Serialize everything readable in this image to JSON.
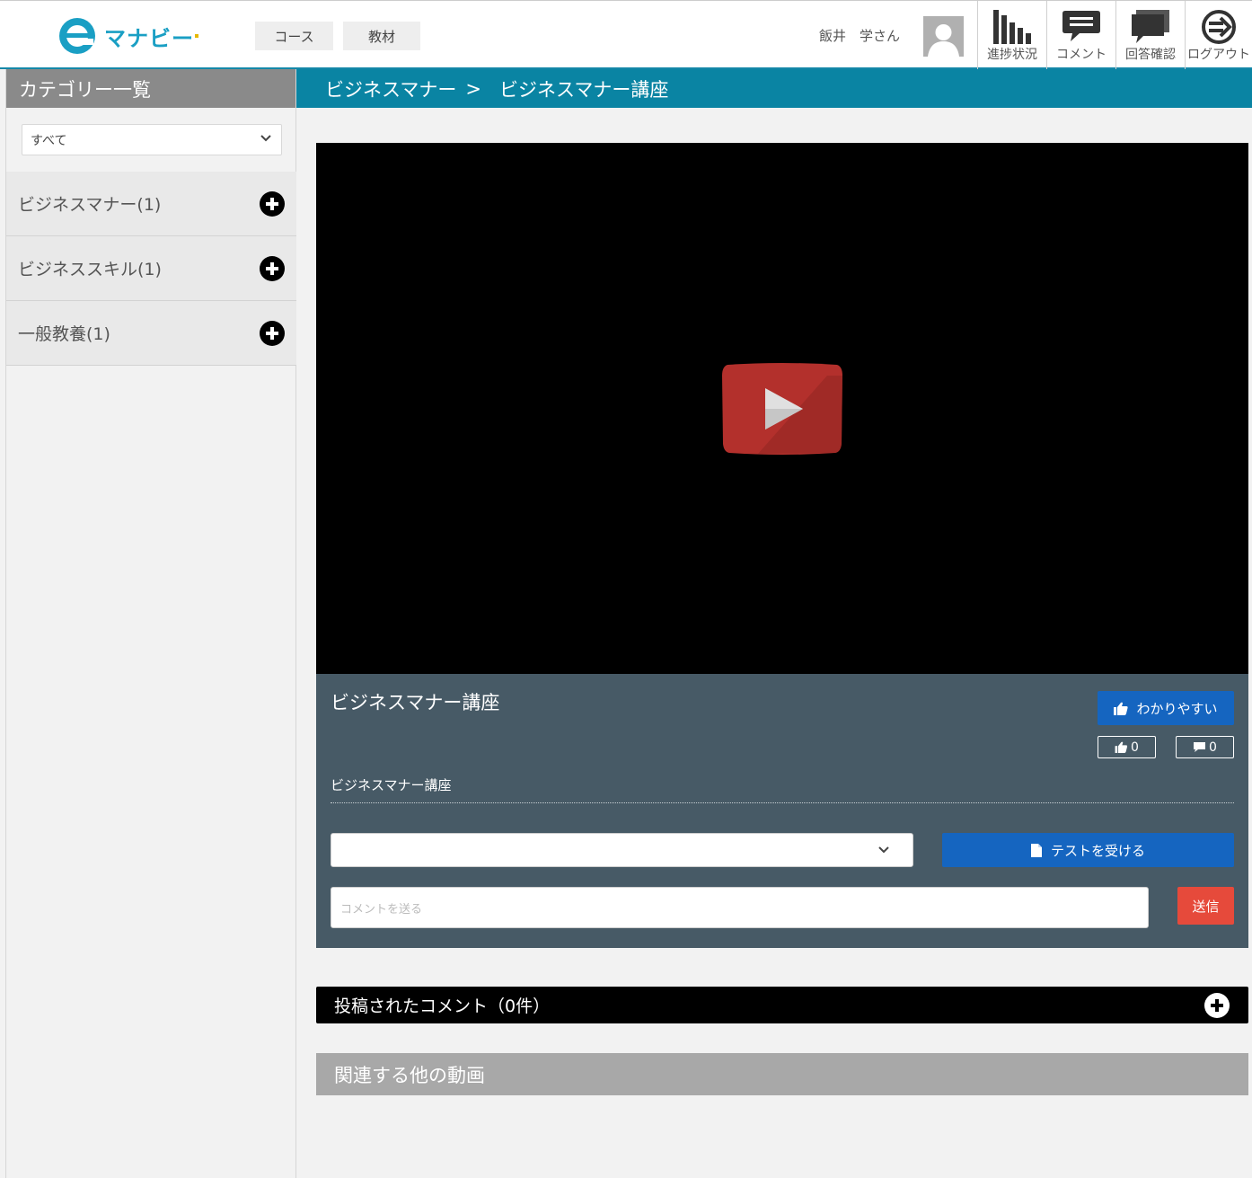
{
  "header": {
    "logo_text": "マナビー",
    "nav": [
      {
        "label": "コース"
      },
      {
        "label": "教材"
      }
    ],
    "user_name": "飯井　学さん",
    "icon_buttons": [
      {
        "label": "進捗状況",
        "icon": "bar-chart-icon"
      },
      {
        "label": "コメント",
        "icon": "comment-icon"
      },
      {
        "label": "回答確認",
        "icon": "answer-check-icon"
      },
      {
        "label": "ログアウト",
        "icon": "logout-icon"
      }
    ]
  },
  "sidebar": {
    "title": "カテゴリー一覧",
    "filter_value": "すべて",
    "categories": [
      {
        "label": "ビジネスマナー(1)"
      },
      {
        "label": "ビジネススキル(1)"
      },
      {
        "label": "一般教養(1)"
      }
    ]
  },
  "breadcrumb": {
    "parent": "ビジネスマナー",
    "separator": ">",
    "current": "ビジネスマナー講座"
  },
  "video": {
    "title": "ビジネスマナー講座",
    "description": "ビジネスマナー講座",
    "like_label": "わかりやすい",
    "like_count": "0",
    "comment_count": "0",
    "test_button_label": "テストを受ける",
    "comment_placeholder": "コメントを送る",
    "send_label": "送信"
  },
  "posted_comments": {
    "label": "投稿されたコメント（0件）"
  },
  "related": {
    "label": "関連する他の動画"
  },
  "colors": {
    "accent": "#0a84a3",
    "primary_button": "#1565c0",
    "send_button": "#e64a3b",
    "info_panel": "#475a66",
    "play_red": "#b3302c"
  }
}
